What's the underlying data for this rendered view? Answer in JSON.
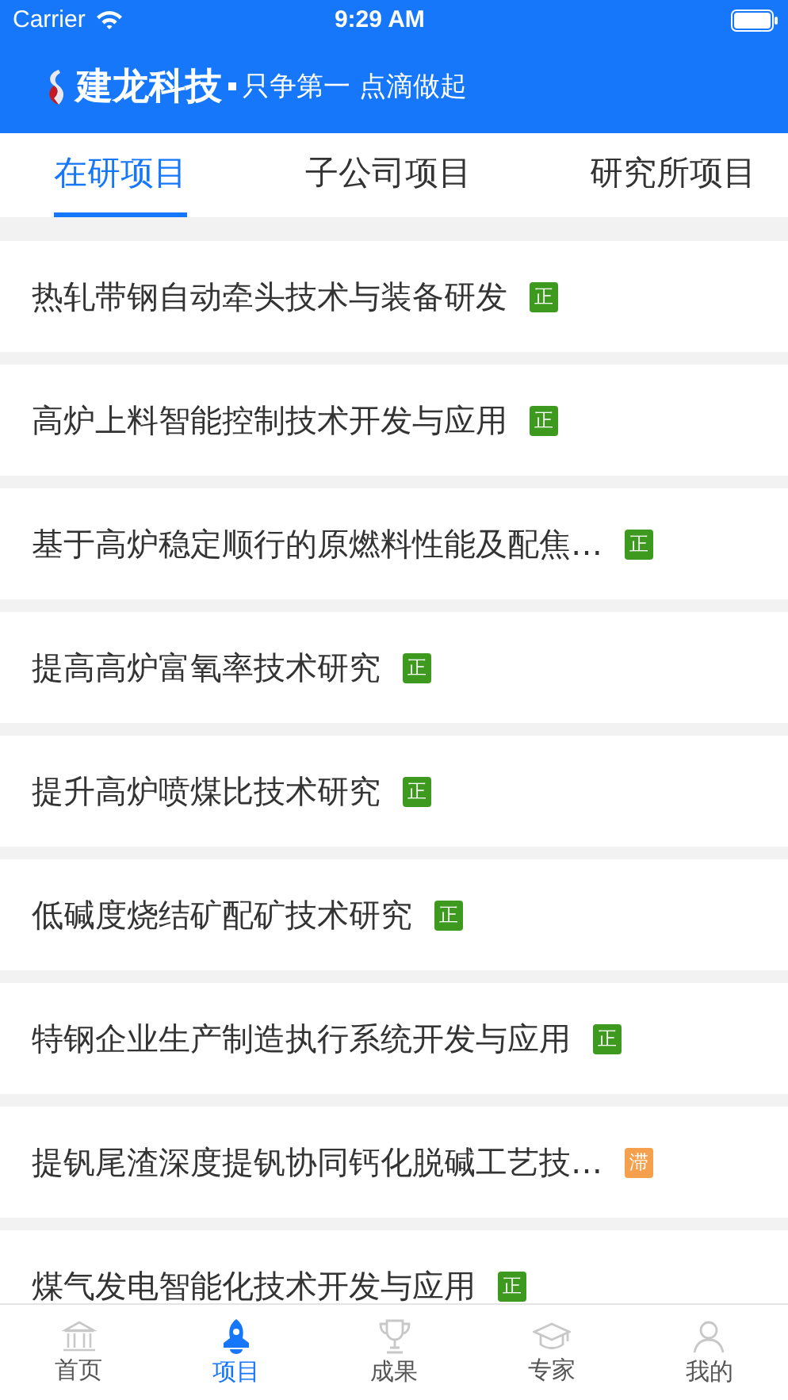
{
  "status_bar": {
    "carrier": "Carrier",
    "time": "9:29 AM"
  },
  "header": {
    "brand": "建龙科技",
    "slogan": "只争第一 点滴做起"
  },
  "tabs": [
    {
      "label": "在研项目",
      "selected": true
    },
    {
      "label": "子公司项目",
      "selected": false
    },
    {
      "label": "研究所项目",
      "selected": false
    }
  ],
  "projects": [
    {
      "title": "热轧带钢自动牵头技术与装备研发",
      "badge": "正",
      "color": "#3d9a1f"
    },
    {
      "title": "高炉上料智能控制技术开发与应用",
      "badge": "正",
      "color": "#3d9a1f"
    },
    {
      "title": "基于高炉稳定顺行的原燃料性能及配焦…",
      "badge": "正",
      "color": "#3d9a1f"
    },
    {
      "title": "提高高炉富氧率技术研究",
      "badge": "正",
      "color": "#3d9a1f"
    },
    {
      "title": "提升高炉喷煤比技术研究",
      "badge": "正",
      "color": "#3d9a1f"
    },
    {
      "title": "低碱度烧结矿配矿技术研究",
      "badge": "正",
      "color": "#3d9a1f"
    },
    {
      "title": "特钢企业生产制造执行系统开发与应用",
      "badge": "正",
      "color": "#3d9a1f"
    },
    {
      "title": "提钒尾渣深度提钒协同钙化脱碱工艺技…",
      "badge": "滞",
      "color": "#f5a04c"
    },
    {
      "title": "煤气发电智能化技术开发与应用",
      "badge": "正",
      "color": "#3d9a1f"
    }
  ],
  "tab_bar": [
    {
      "label": "首页",
      "kind": "home",
      "selected": false
    },
    {
      "label": "项目",
      "kind": "rocket",
      "selected": true
    },
    {
      "label": "成果",
      "kind": "trophy",
      "selected": false
    },
    {
      "label": "专家",
      "kind": "cap",
      "selected": false
    },
    {
      "label": "我的",
      "kind": "person",
      "selected": false
    }
  ]
}
